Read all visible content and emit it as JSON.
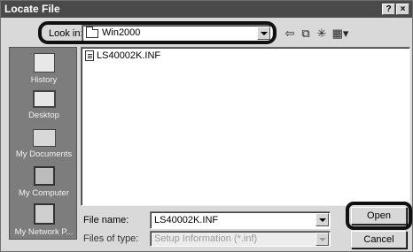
{
  "window": {
    "title": "Locate File",
    "help_glyph": "?",
    "close_glyph": "×"
  },
  "lookin": {
    "label": "Look in:",
    "value": "Win2000",
    "icon": "folder-icon"
  },
  "toolbar": {
    "icons": [
      "back-arrow-icon",
      "up-folder-icon",
      "new-folder-icon",
      "view-menu-icon"
    ]
  },
  "places": [
    {
      "label": "History",
      "icon": "history-icon"
    },
    {
      "label": "Desktop",
      "icon": "desktop-icon"
    },
    {
      "label": "My Documents",
      "icon": "my-documents-icon"
    },
    {
      "label": "My Computer",
      "icon": "my-computer-icon"
    },
    {
      "label": "My Network P...",
      "icon": "network-places-icon"
    }
  ],
  "files": [
    {
      "name": "LS40002K.INF",
      "icon": "inf-file-icon"
    }
  ],
  "form": {
    "filename_label": "File name:",
    "filename_value": "LS40002K.INF",
    "filetype_label": "Files of type:",
    "filetype_value": "Setup Information (*.inf)"
  },
  "buttons": {
    "open": "Open",
    "cancel": "Cancel"
  }
}
